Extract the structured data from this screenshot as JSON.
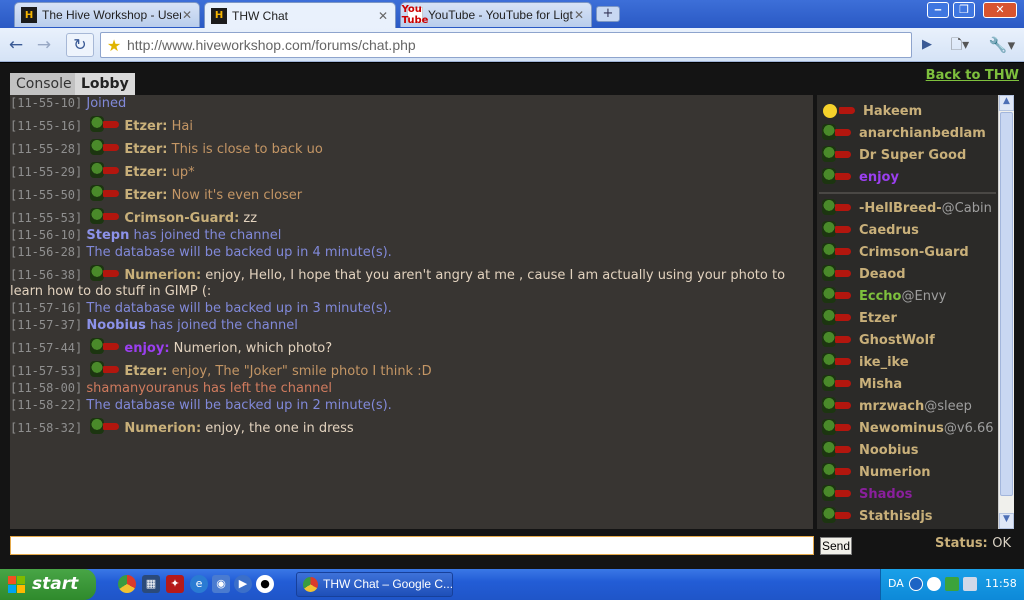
{
  "browser": {
    "tabs": [
      {
        "title": "The Hive Workshop - User ...",
        "icon": "H"
      },
      {
        "title": "THW Chat",
        "icon": "H"
      },
      {
        "title": "YouTube - YouTube for Ligt...",
        "icon": "You Tube"
      }
    ],
    "new_tab": "+",
    "url": "http://www.hiveworkshop.com/forums/chat.php"
  },
  "page": {
    "tabs": [
      "Console",
      "Lobby"
    ],
    "back_link": "Back to THW",
    "send_label": "Send",
    "status_label": "Status:",
    "status_value": "OK",
    "input_value": ""
  },
  "messages": [
    {
      "time": "[11-55-10]",
      "kind": "sys",
      "text": "Joined"
    },
    {
      "time": "[11-55-16]",
      "kind": "user",
      "user": "Etzer:",
      "text": "Hai"
    },
    {
      "time": "[11-55-28]",
      "kind": "user",
      "user": "Etzer:",
      "text": "This is close to back uo"
    },
    {
      "time": "[11-55-29]",
      "kind": "user",
      "user": "Etzer:",
      "text": "up*"
    },
    {
      "time": "[11-55-50]",
      "kind": "user",
      "user": "Etzer:",
      "text": "Now it's even closer"
    },
    {
      "time": "[11-55-53]",
      "kind": "user",
      "user": "Crimson-Guard:",
      "text": "zz",
      "text_style": "white"
    },
    {
      "time": "[11-56-10]",
      "kind": "joined",
      "user": "Stepn",
      "text": "has joined the channel"
    },
    {
      "time": "[11-56-28]",
      "kind": "sys",
      "text": "The database will be backed up in 4 minute(s)."
    },
    {
      "time": "[11-56-38]",
      "kind": "user",
      "user": "Numerion:",
      "text": "enjoy, Hello, I hope that you aren't angry at me , cause I am actually using your photo to learn how to do stuff in GIMP (:",
      "text_style": "white"
    },
    {
      "time": "[11-57-16]",
      "kind": "sys",
      "text": "The database will be backed up in 3 minute(s)."
    },
    {
      "time": "[11-57-37]",
      "kind": "joined",
      "user": "Noobius",
      "text": "has joined the channel"
    },
    {
      "time": "[11-57-44]",
      "kind": "user",
      "user": "enjoy:",
      "text": "Numerion, which photo?",
      "user_style": "purple",
      "text_style": "white"
    },
    {
      "time": "[11-57-53]",
      "kind": "user",
      "user": "Etzer:",
      "text": "enjoy, The \"Joker\" smile photo I think :D"
    },
    {
      "time": "[11-58-00]",
      "kind": "leave",
      "text": "shamanyouranus has left the channel"
    },
    {
      "time": "[11-58-22]",
      "kind": "sys",
      "text": "The database will be backed up in 2 minute(s)."
    },
    {
      "time": "[11-58-32]",
      "kind": "user",
      "user": "Numerion:",
      "text": "enjoy, the one in dress",
      "text_style": "white"
    }
  ],
  "users_top": [
    {
      "name": "Hakeem",
      "smile": true
    },
    {
      "name": "anarchianbedlam"
    },
    {
      "name": "Dr Super Good"
    },
    {
      "name": "enjoy",
      "color": "#9b3ff0"
    }
  ],
  "users": [
    {
      "name": "-HellBreed-",
      "sub": "@Cabin"
    },
    {
      "name": "Caedrus"
    },
    {
      "name": "Crimson-Guard"
    },
    {
      "name": "Deaod"
    },
    {
      "name": "Eccho",
      "sub": "@Envy",
      "color": "#7ec03d"
    },
    {
      "name": "Etzer"
    },
    {
      "name": "GhostWolf"
    },
    {
      "name": "ike_ike"
    },
    {
      "name": "Misha"
    },
    {
      "name": "mrzwach",
      "sub": "@sleep"
    },
    {
      "name": "Newominus",
      "sub": "@v6.66"
    },
    {
      "name": "Noobius"
    },
    {
      "name": "Numerion"
    },
    {
      "name": "Shados",
      "color": "#8a1f9c"
    },
    {
      "name": "Stathisdjs"
    }
  ],
  "taskbar": {
    "start_label": "start",
    "task": "THW Chat – Google C...",
    "lang": "DA",
    "clock": "11:58"
  }
}
